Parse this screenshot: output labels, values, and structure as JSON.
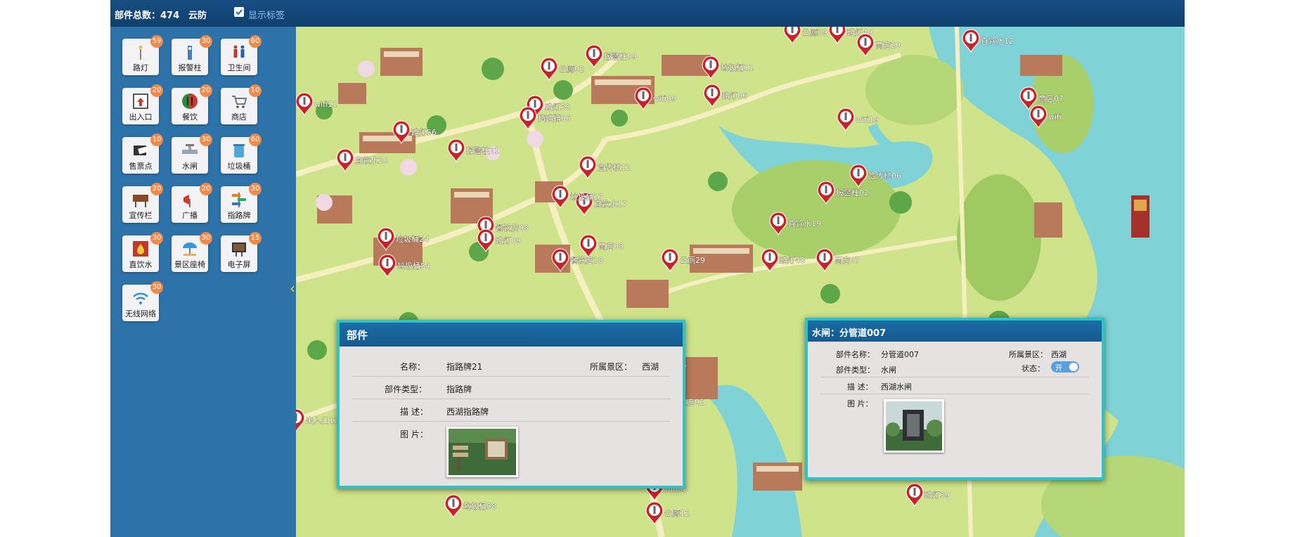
{
  "topbar": {
    "count_label": "部件总数：474",
    "cloud_label": "云防",
    "show_labels": "显示标签",
    "show_labels_checked": true
  },
  "categories": [
    {
      "label": "路灯",
      "count": "59",
      "icon": "street-lamp-icon"
    },
    {
      "label": "报警柱",
      "count": "30",
      "icon": "alarm-pillar-icon"
    },
    {
      "label": "卫生间",
      "count": "60",
      "icon": "restroom-icon"
    },
    {
      "label": "出入口",
      "count": "20",
      "icon": "entrance-icon"
    },
    {
      "label": "餐饮",
      "count": "20",
      "icon": "dining-icon"
    },
    {
      "label": "商店",
      "count": "10",
      "icon": "shopping-cart-icon"
    },
    {
      "label": "售票点",
      "count": "10",
      "icon": "ticket-icon"
    },
    {
      "label": "水闸",
      "count": "30",
      "icon": "water-valve-icon"
    },
    {
      "label": "垃圾桶",
      "count": "60",
      "icon": "trash-bin-icon"
    },
    {
      "label": "宣传栏",
      "count": "20",
      "icon": "billboard-icon"
    },
    {
      "label": "广播",
      "count": "20",
      "icon": "broadcast-icon"
    },
    {
      "label": "指路牌",
      "count": "30",
      "icon": "signpost-icon"
    },
    {
      "label": "直饮水",
      "count": "30",
      "icon": "drinking-water-icon"
    },
    {
      "label": "景区座椅",
      "count": "30",
      "icon": "bench-icon"
    },
    {
      "label": "电子屏",
      "count": "15",
      "icon": "screen-icon"
    },
    {
      "label": "无线网络",
      "count": "30",
      "icon": "wifi-icon"
    }
  ],
  "map_labels": [
    "wifi11",
    "路灯56",
    "直饮水20",
    "直饮水17",
    "垃圾桶54",
    "公厕02",
    "路灯58",
    "wifi09",
    "指路牌06",
    "宣传栏12",
    "垃圾桶17",
    "商店08",
    "餐饮店18",
    "公厕29",
    "路灯48",
    "直饮水19",
    "wifi19",
    "宣传栏06",
    "报警柱02",
    "商店07",
    "垃圾桶11",
    "路灯06",
    "商店07",
    "wifi",
    "公厕39",
    "路灯49",
    "直饮水12",
    "餐饮店08",
    "路灯09",
    "公厕04",
    "商店02",
    "垃圾桶58",
    "wifi05",
    "公厕12",
    "餐饮店02",
    "出入口12",
    "路灯39",
    "商店20",
    "报警柱09",
    "报警柱21",
    "垃圾桶24"
  ],
  "panel_component": {
    "title": "部件",
    "name_label": "名称：",
    "name_value": "指路牌21",
    "area_label": "所属景区：",
    "area_value": "西湖",
    "type_label": "部件类型：",
    "type_value": "指路牌",
    "desc_label": "描 述：",
    "desc_value": "西湖指路牌",
    "image_label": "图 片："
  },
  "panel_valve": {
    "title": "水闸：分管道007",
    "name_label": "部件名称：",
    "name_value": "分管道007",
    "area_label": "所属景区：",
    "area_value": "西湖",
    "status_label": "状态：",
    "status_value": "开",
    "type_label": "部件类型：",
    "type_value": "水闸",
    "desc_label": "描 述：",
    "desc_value": "西湖水闸",
    "image_label": "图 片："
  },
  "colors": {
    "topbar": "#174e82",
    "sidebar": "#2d74aa",
    "badge": "#ef8a4a",
    "panel_border": "#2ec3c9",
    "water": "#7fd3d6",
    "land": "#cfe38a",
    "pin": "#c8232b"
  }
}
